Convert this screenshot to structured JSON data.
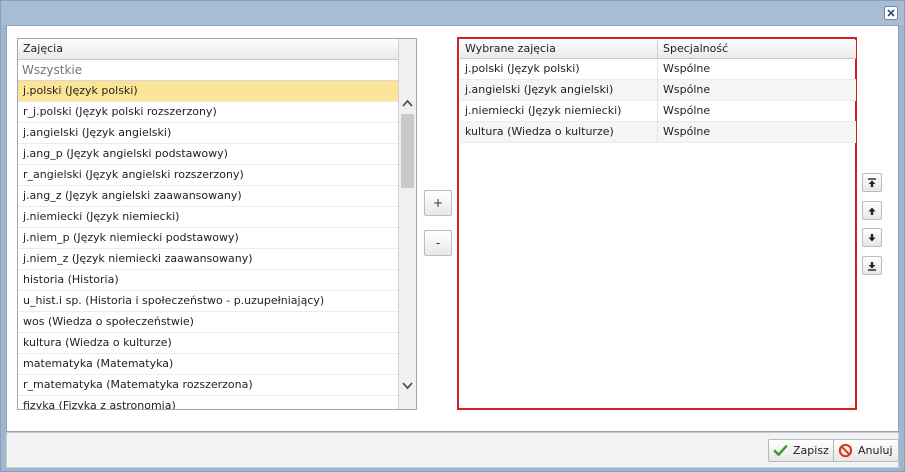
{
  "left_list": {
    "header": "Zajęcia",
    "filter_placeholder": "Wszystkie",
    "items": [
      "j.polski (Język polski)",
      "r_j.polski (Język polski rozszerzony)",
      "j.angielski (Język angielski)",
      "j.ang_p (Język angielski podstawowy)",
      "r_angielski (Język angielski rozszerzony)",
      "j.ang_z (Język angielski zaawansowany)",
      "j.niemiecki (Język niemiecki)",
      "j.niem_p (Język niemiecki podstawowy)",
      "j.niem_z (Język niemiecki zaawansowany)",
      "historia (Historia)",
      "u_hist.i sp. (Historia i społeczeństwo - p.uzupełniający)",
      "wos (Wiedza o społeczeństwie)",
      "kultura (Wiedza o kulturze)",
      "matematyka (Matematyka)",
      "r_matematyka (Matematyka rozszerzona)",
      "fizyka (Fizyka z astronomią)"
    ],
    "selected_index": 0
  },
  "middle": {
    "add_label": "+",
    "remove_label": "-"
  },
  "right_table": {
    "col1": "Wybrane zajęcia",
    "col2": "Specjalność",
    "rows": [
      {
        "subject": "j.polski (Język polski)",
        "spec": "Wspólne"
      },
      {
        "subject": "j.angielski (Język angielski)",
        "spec": "Wspólne"
      },
      {
        "subject": "j.niemiecki (Język niemiecki)",
        "spec": "Wspólne"
      },
      {
        "subject": "kultura (Wiedza o kulturze)",
        "spec": "Wspólne"
      }
    ]
  },
  "order_buttons": [
    "move-top-icon",
    "move-up-icon",
    "move-down-icon",
    "move-bottom-icon"
  ],
  "footer": {
    "save_label": "Zapisz",
    "cancel_label": "Anuluj"
  },
  "colors": {
    "selected_row": "#fce497",
    "highlight_border": "#d32020",
    "save_icon": "#3a9a2a",
    "cancel_icon": "#d9381e"
  }
}
